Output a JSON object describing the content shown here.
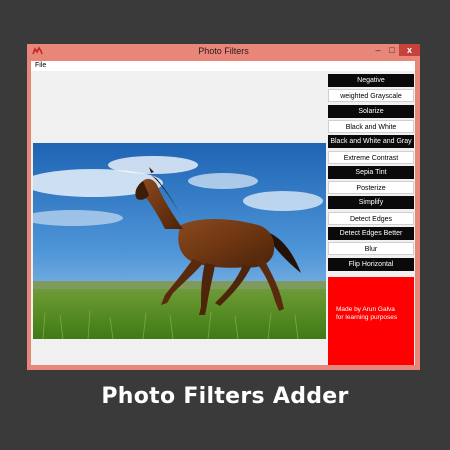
{
  "window": {
    "title": "Photo Filters",
    "controls": {
      "minimize": "–",
      "maximize": "□",
      "close": "x"
    }
  },
  "menu": {
    "file": "File"
  },
  "filters": [
    {
      "label": "Negative",
      "style": "dark"
    },
    {
      "label": "weighted Grayscale",
      "style": "light"
    },
    {
      "label": "Solarize",
      "style": "dark"
    },
    {
      "label": "Black and White",
      "style": "light"
    },
    {
      "label": "Black and White and Gray",
      "style": "dark"
    },
    {
      "label": "Extreme Contrast",
      "style": "light"
    },
    {
      "label": "Sepia Tint",
      "style": "dark"
    },
    {
      "label": "Posterize",
      "style": "light"
    },
    {
      "label": "Simplify",
      "style": "dark"
    },
    {
      "label": "Detect Edges",
      "style": "light"
    },
    {
      "label": "Detect Edges Better",
      "style": "dark"
    },
    {
      "label": "Blur",
      "style": "light"
    },
    {
      "label": "Flip Horizontal",
      "style": "dark"
    }
  ],
  "credit": {
    "line1": "Made by Arun Galva",
    "line2": "for learning purposes"
  },
  "caption": "Photo Filters Adder",
  "colors": {
    "titlebar": "#e8867a",
    "close_button": "#c7423a",
    "credit_panel": "#ff0000",
    "background": "#3a3a3a"
  },
  "photo_subject": "brown horse running on grass field under blue sky"
}
